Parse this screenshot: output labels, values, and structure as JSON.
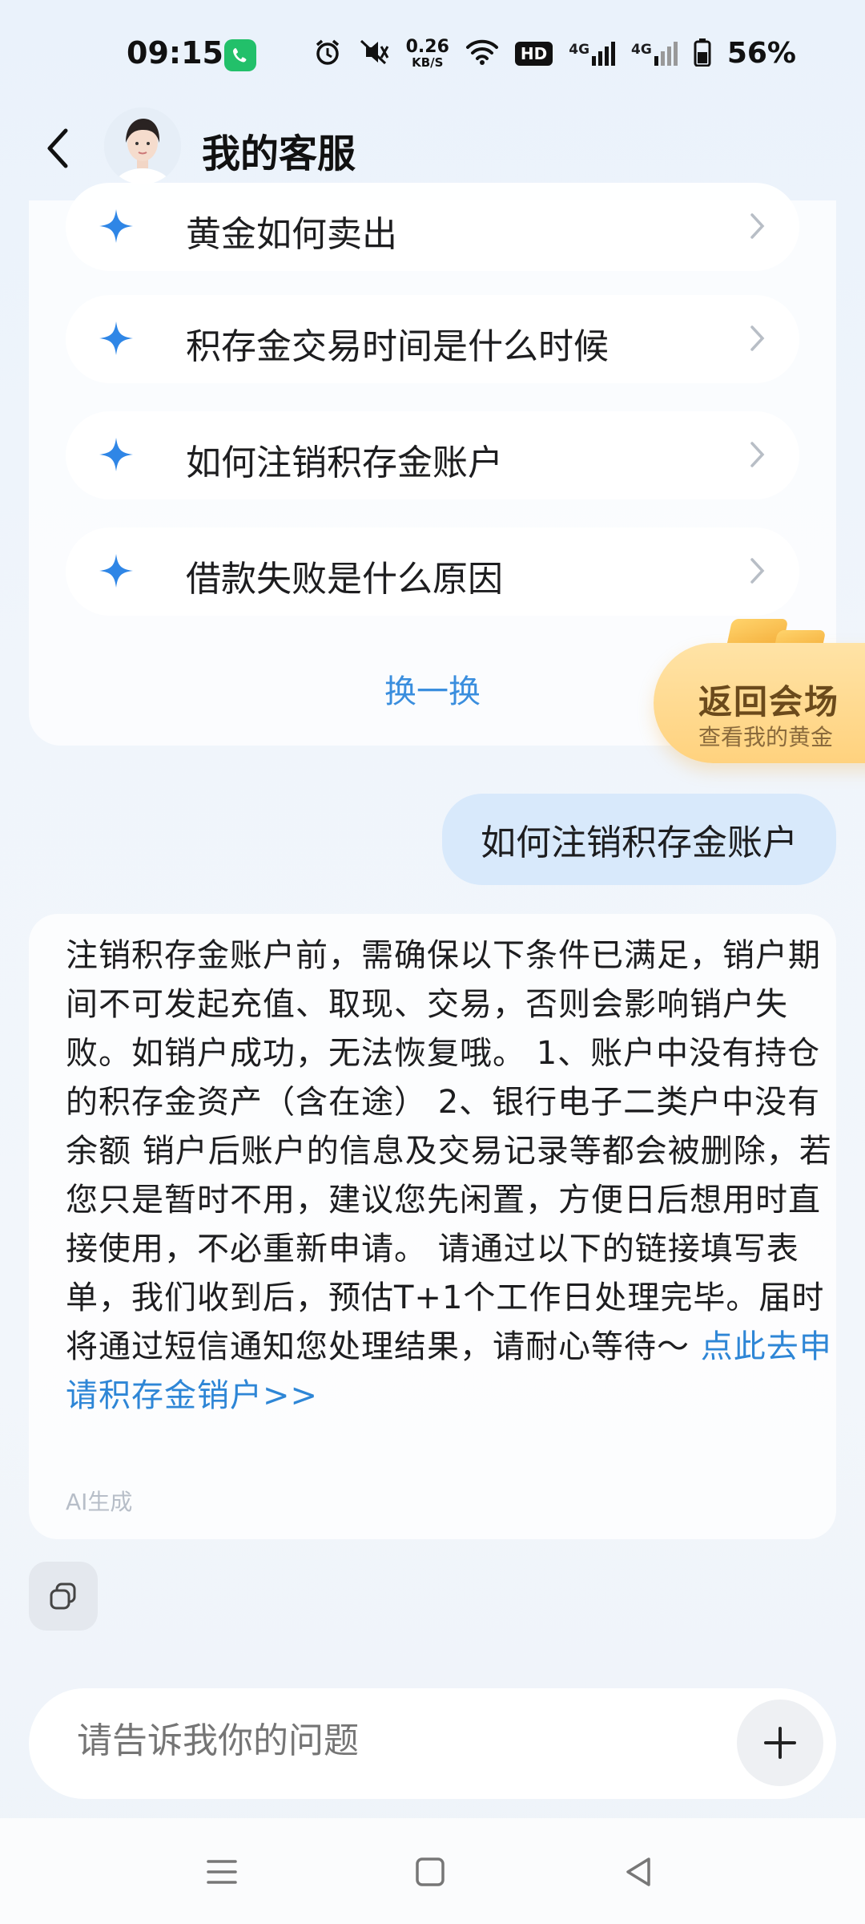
{
  "status_bar": {
    "time": "09:15",
    "speed_value": "0.26",
    "speed_unit": "KB/S",
    "hd_label": "HD",
    "net_1": "4G",
    "net_2": "4G",
    "battery": "56%"
  },
  "header": {
    "title": "我的客服"
  },
  "suggestions": {
    "items": [
      {
        "label": "黄金如何卖出"
      },
      {
        "label": "积存金交易时间是什么时候"
      },
      {
        "label": "如何注销积存金账户"
      },
      {
        "label": "借款失败是什么原因"
      }
    ],
    "refresh_label": "换一换"
  },
  "promo": {
    "title": "返回会场",
    "subtitle": "查看我的黄金"
  },
  "user_message": "如何注销积存金账户",
  "answer": {
    "text": "注销积存金账户前，需确保以下条件已满足，销户期间不可发起充值、取现、交易，否则会影响销户失败。如销户成功，无法恢复哦。 1、账户中没有持仓的积存金资产（含在途） 2、银行电子二类户中没有余额 销户后账户的信息及交易记录等都会被删除，若您只是暂时不用，建议您先闲置，方便日后想用时直接使用，不必重新申请。 请通过以下的链接填写表单，我们收到后，预估T+1个工作日处理完毕。届时将通过短信通知您处理结果，请耐心等待～ ",
    "link": "点此去申请积存金销户>>",
    "ai_tag": "AI生成"
  },
  "input": {
    "placeholder": "请告诉我你的问题"
  },
  "colors": {
    "accent": "#2e86d6",
    "star": "#2f86e6",
    "bubble": "#d8e9fb"
  }
}
